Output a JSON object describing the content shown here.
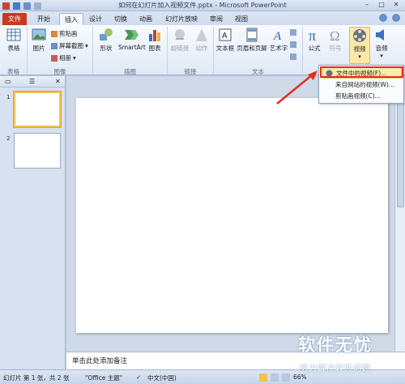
{
  "window": {
    "title": "如何在幻灯片加入视频文件.pptx - Microsoft PowerPoint"
  },
  "tabs": [
    {
      "label": "文件"
    },
    {
      "label": "开始"
    },
    {
      "label": "插入"
    },
    {
      "label": "设计"
    },
    {
      "label": "切换"
    },
    {
      "label": "动画"
    },
    {
      "label": "幻灯片放映"
    },
    {
      "label": "审阅"
    },
    {
      "label": "视图"
    }
  ],
  "ribbon": {
    "table": "表格",
    "picture": "图片",
    "clipart": "剪贴画",
    "screenshot": "屏幕截图",
    "album": "相册",
    "shapes": "形状",
    "smartart": "SmartArt",
    "chart": "图表",
    "hyperlink": "超链接",
    "action": "动作",
    "textbox": "文本框",
    "header_footer": "页眉和页脚",
    "wordart": "艺术字",
    "equation": "公式",
    "symbol": "符号",
    "video": "视频",
    "audio": "音频",
    "groups": {
      "tables": "表格",
      "images": "图像",
      "illustrations": "插图",
      "links": "链接",
      "text": "文本"
    }
  },
  "video_menu": {
    "items": [
      {
        "label": "文件中的视频(F)..."
      },
      {
        "label": "来自网站的视频(W)..."
      },
      {
        "label": "剪贴画视频(C)..."
      }
    ]
  },
  "slides_panel": {
    "numbers": [
      "1",
      "2"
    ]
  },
  "notes": {
    "placeholder": "单击此处添加备注"
  },
  "status": {
    "slide_info": "幻灯片 第 1 张，共 2 张",
    "theme": "\"Office 主题\"",
    "language": "中文(中国)",
    "zoom": "66%"
  },
  "watermark": {
    "big": "软件无忧",
    "small": "努力解决软件问题"
  },
  "colors": {
    "file_tab": "#c73a20",
    "highlight": "#fdeab0",
    "callout_red": "#e0301e"
  }
}
